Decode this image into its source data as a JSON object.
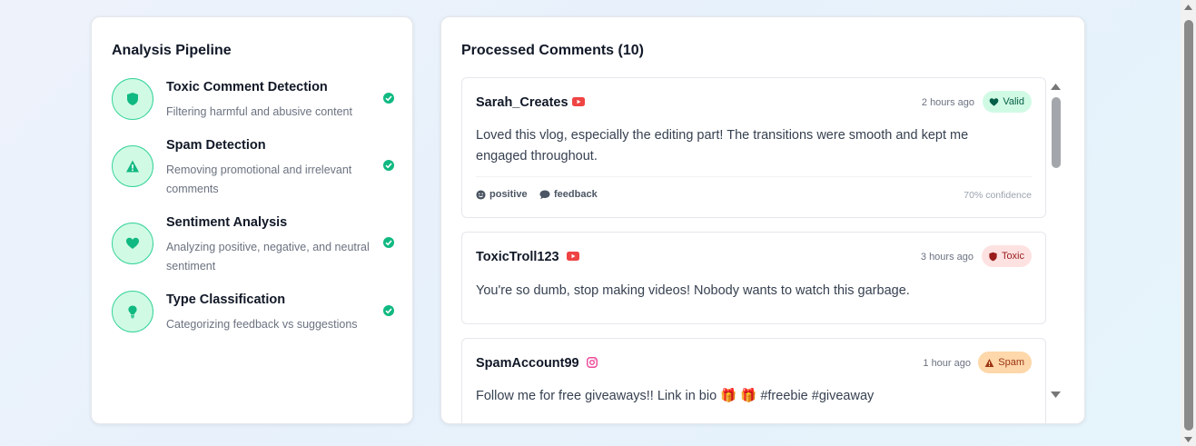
{
  "pipeline": {
    "title": "Analysis Pipeline",
    "steps": [
      {
        "title": "Toxic Comment Detection",
        "desc": "Filtering harmful and abusive content",
        "icon": "shield-icon"
      },
      {
        "title": "Spam Detection",
        "desc": "Removing promotional and irrelevant comments",
        "icon": "warning-icon"
      },
      {
        "title": "Sentiment Analysis",
        "desc": "Analyzing positive, negative, and neutral sentiment",
        "icon": "heart-icon"
      },
      {
        "title": "Type Classification",
        "desc": "Categorizing feedback vs suggestions",
        "icon": "lightbulb-icon"
      }
    ],
    "status": "complete",
    "accent_color": "#10b981"
  },
  "comments": {
    "title": "Processed Comments (10)",
    "items": [
      {
        "author": "Sarah_Creates",
        "platform": "youtube",
        "time": "2 hours ago",
        "badge": "Valid",
        "text": "Loved this vlog, especially the editing part! The transitions were smooth and kept me engaged throughout.",
        "sentiment": "positive",
        "type": "feedback",
        "confidence": "70% confidence"
      },
      {
        "author": "ToxicTroll123",
        "platform": "youtube",
        "time": "3 hours ago",
        "badge": "Toxic",
        "text": "You're so dumb, stop making videos! Nobody wants to watch this garbage."
      },
      {
        "author": "SpamAccount99",
        "platform": "instagram",
        "time": "1 hour ago",
        "badge": "Spam",
        "text": "Follow me for free giveaways!! Link in bio 🎁 🎁  #freebie #giveaway"
      }
    ]
  },
  "colors": {
    "valid_bg": "#d1fae5",
    "toxic_bg": "#fee2e2",
    "spam_bg": "#fed7aa",
    "youtube": "#ef4444",
    "instagram": "#ec4899"
  }
}
